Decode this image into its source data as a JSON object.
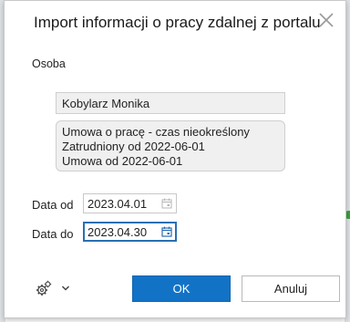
{
  "dialog": {
    "title": "Import informacji o pracy zdalnej z portalu",
    "close_icon": "close-icon"
  },
  "person": {
    "section_label": "Osoba",
    "name": "Kobylarz Monika",
    "contract_lines": [
      "Umowa o pracę - czas nieokreślony",
      "Zatrudniony od 2022-06-01",
      "Umowa od 2022-06-01"
    ]
  },
  "date_from": {
    "label": "Data od",
    "value": "2023.04.01",
    "icon": "calendar-icon"
  },
  "date_to": {
    "label": "Data do",
    "value": "2023.04.30",
    "icon": "calendar-icon"
  },
  "footer": {
    "settings_icon": "gears-icon",
    "dropdown_icon": "chevron-down-icon",
    "ok_label": "OK",
    "cancel_label": "Anuluj"
  },
  "colors": {
    "primary": "#1273c6",
    "focus_border": "#2a6fb2",
    "readonly_bg": "#f0f0f0"
  }
}
